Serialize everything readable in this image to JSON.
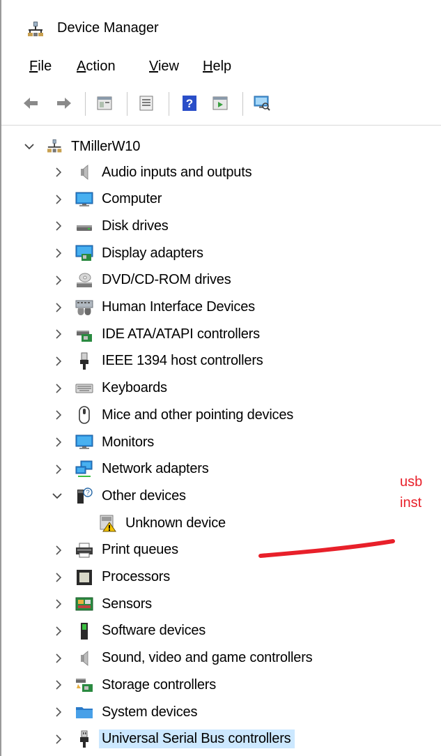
{
  "window": {
    "title": "Device Manager"
  },
  "menu": {
    "file": "File",
    "action": "Action",
    "view": "View",
    "help": "Help"
  },
  "toolbar": {
    "buttons": [
      "back-icon",
      "forward-icon",
      "properties-icon",
      "show-hide-console-icon",
      "help-icon",
      "run-icon",
      "scan-hardware-icon"
    ]
  },
  "tree": {
    "root": "TMillerW10",
    "categories": [
      {
        "label": "Audio inputs and outputs",
        "icon": "speaker-icon"
      },
      {
        "label": "Computer",
        "icon": "monitor-icon"
      },
      {
        "label": "Disk drives",
        "icon": "disk-drive-icon"
      },
      {
        "label": "Display adapters",
        "icon": "display-adapter-icon"
      },
      {
        "label": "DVD/CD-ROM drives",
        "icon": "dvd-drive-icon"
      },
      {
        "label": "Human Interface Devices",
        "icon": "hid-icon"
      },
      {
        "label": "IDE ATA/ATAPI controllers",
        "icon": "ide-controller-icon"
      },
      {
        "label": "IEEE 1394 host controllers",
        "icon": "ieee1394-icon"
      },
      {
        "label": "Keyboards",
        "icon": "keyboard-icon"
      },
      {
        "label": "Mice and other pointing devices",
        "icon": "mouse-icon"
      },
      {
        "label": "Monitors",
        "icon": "monitor-icon"
      },
      {
        "label": "Network adapters",
        "icon": "network-adapter-icon"
      },
      {
        "label": "Other devices",
        "icon": "other-devices-icon",
        "expanded": true
      },
      {
        "label": "Unknown device",
        "icon": "unknown-device-warning-icon",
        "child": true
      },
      {
        "label": "Print queues",
        "icon": "printer-icon"
      },
      {
        "label": "Processors",
        "icon": "processor-icon"
      },
      {
        "label": "Sensors",
        "icon": "sensor-icon"
      },
      {
        "label": "Software devices",
        "icon": "software-device-icon"
      },
      {
        "label": "Sound, video and game controllers",
        "icon": "speaker-icon"
      },
      {
        "label": "Storage controllers",
        "icon": "storage-controller-icon"
      },
      {
        "label": "System devices",
        "icon": "folder-icon"
      },
      {
        "label": "Universal Serial Bus controllers",
        "icon": "usb-icon",
        "selected": true
      }
    ]
  },
  "annotation": {
    "line1": "usb",
    "line2": "inst",
    "color": "#e8202a"
  },
  "colors": {
    "selection": "#cce8ff",
    "accent": "#1e88e5"
  }
}
